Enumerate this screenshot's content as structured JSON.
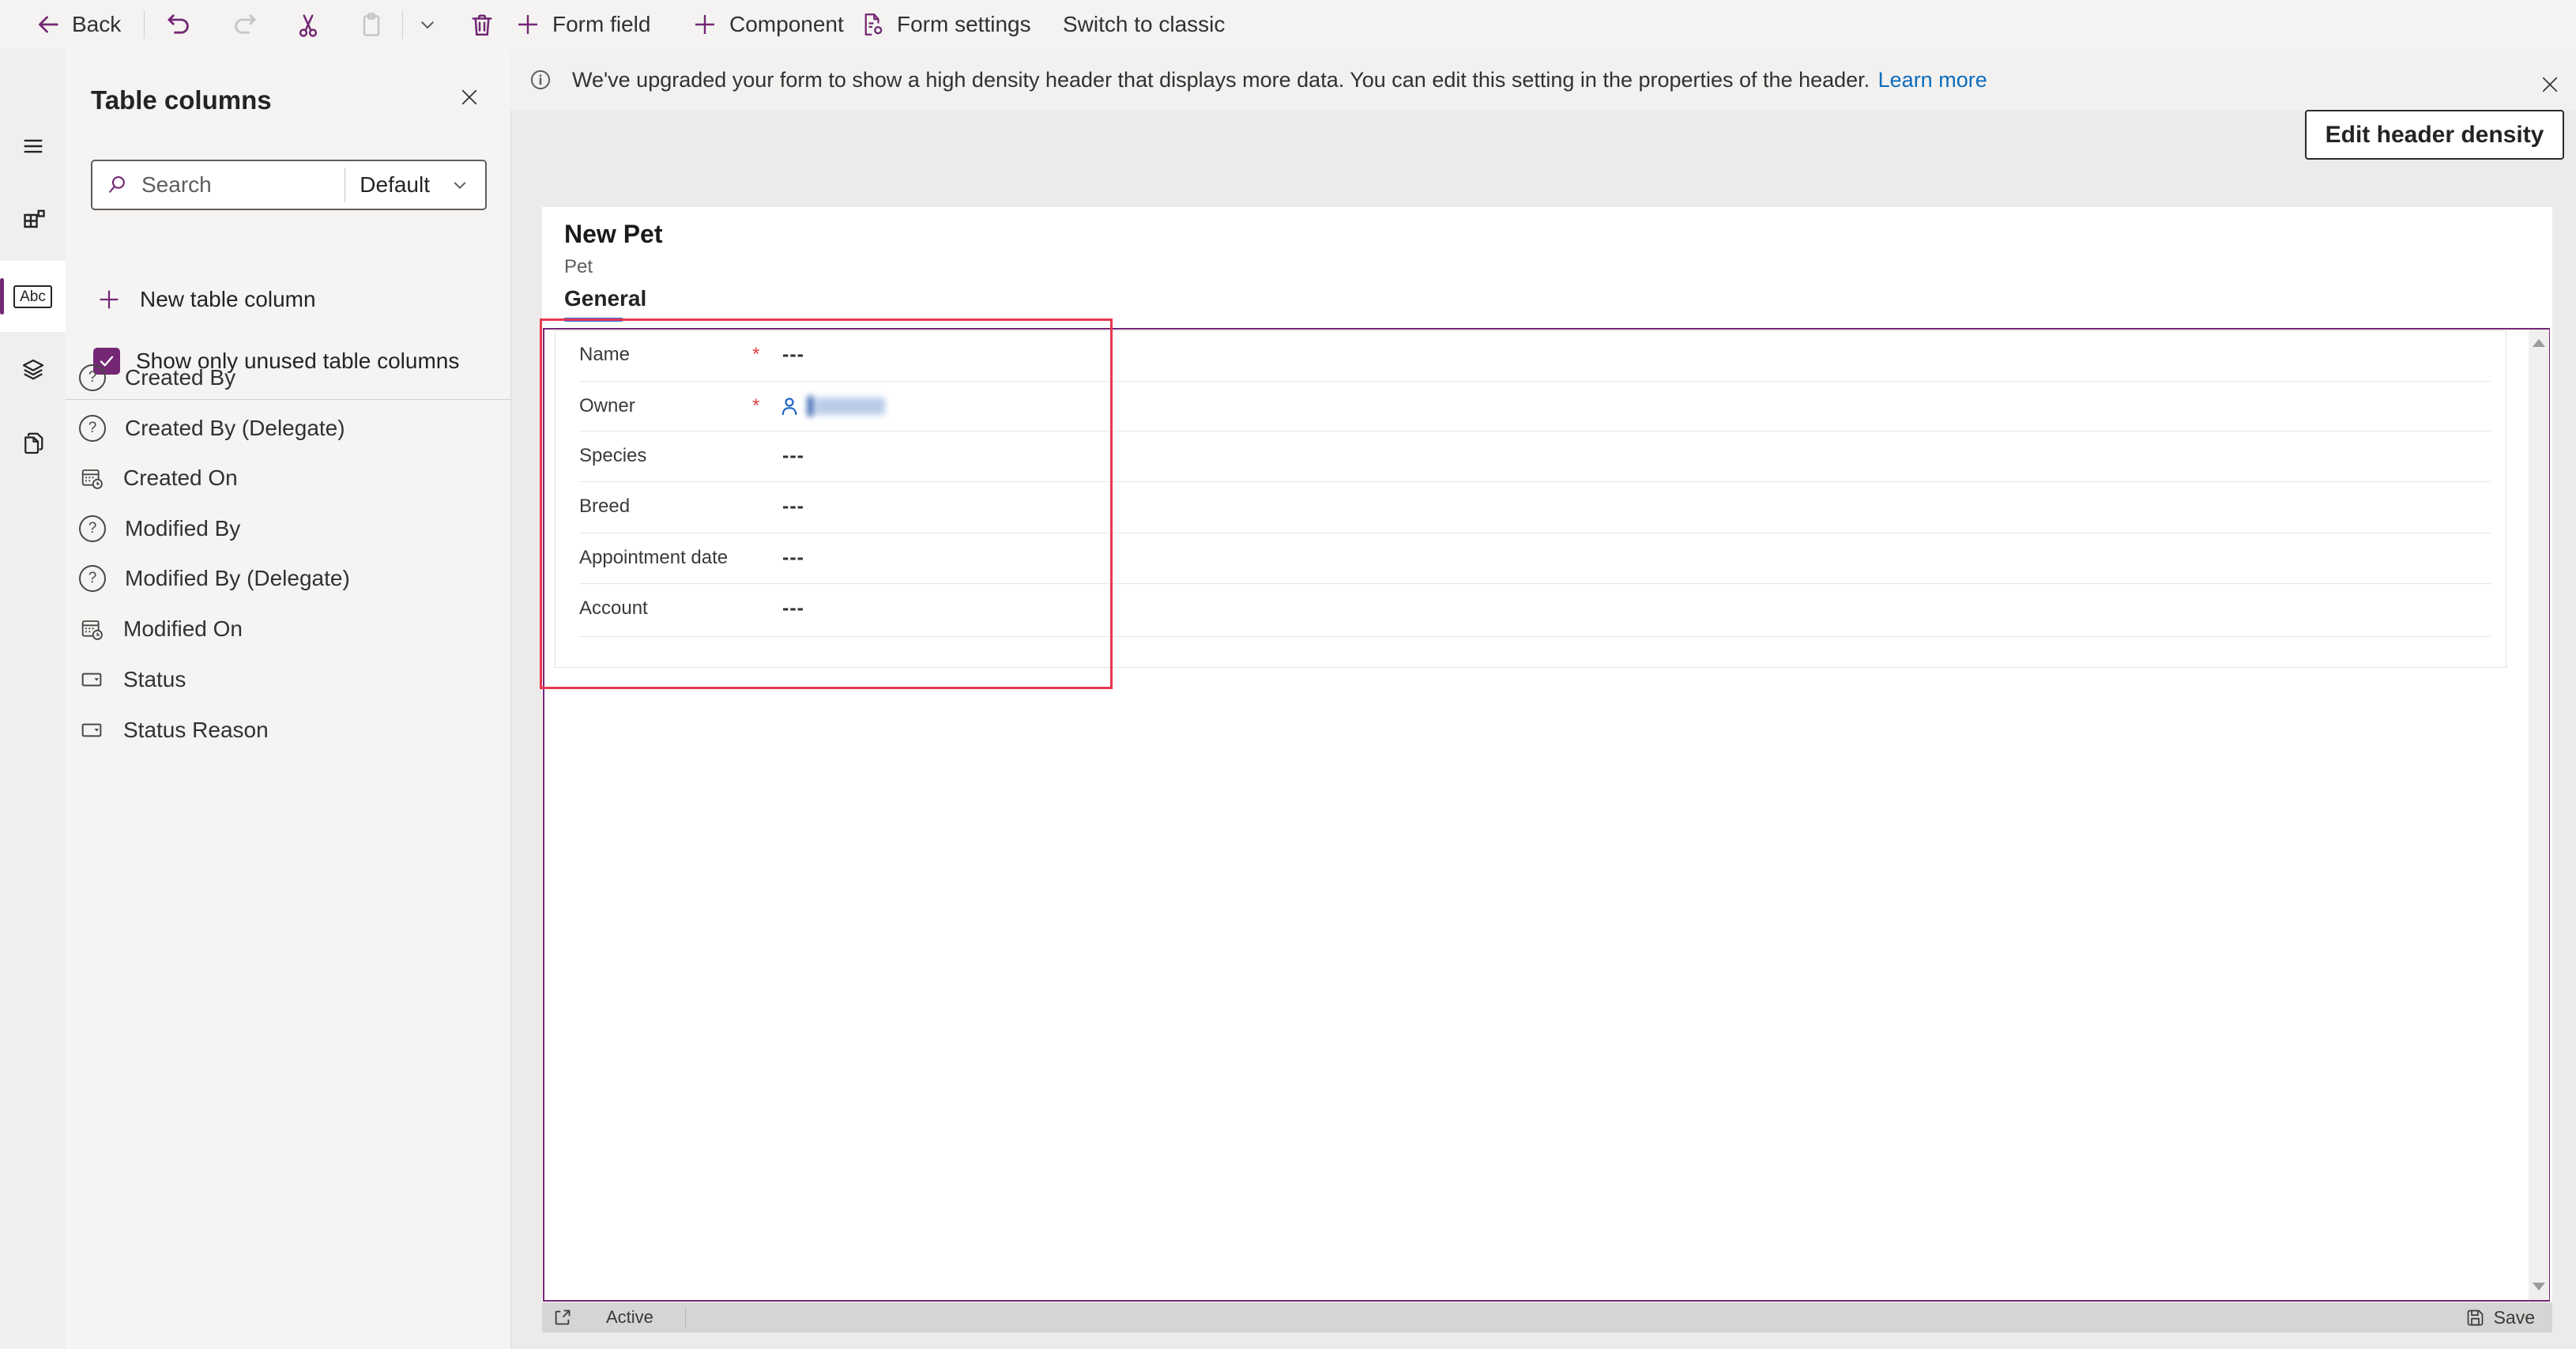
{
  "toolbar": {
    "back": "Back",
    "form_field": "Form field",
    "component": "Component",
    "form_settings": "Form settings",
    "switch_to_classic": "Switch to classic"
  },
  "left_rail": {
    "icons": [
      "hamburger-menu",
      "page-layout",
      "table-columns-abc",
      "layers",
      "copy-pages"
    ],
    "abc_glyph": "Abc",
    "selected": "table-columns-abc"
  },
  "panel": {
    "title": "Table columns",
    "search_placeholder": "Search",
    "filter_value": "Default",
    "new_table_column": "New table column",
    "show_unused": "Show only unused table columns",
    "show_unused_checked": true,
    "columns": [
      {
        "label": "Created By",
        "icon": "question-circle"
      },
      {
        "label": "Created By (Delegate)",
        "icon": "question-circle"
      },
      {
        "label": "Created On",
        "icon": "calendar-clock"
      },
      {
        "label": "Modified By",
        "icon": "question-circle"
      },
      {
        "label": "Modified By (Delegate)",
        "icon": "question-circle"
      },
      {
        "label": "Modified On",
        "icon": "calendar-clock"
      },
      {
        "label": "Status",
        "icon": "option-set"
      },
      {
        "label": "Status Reason",
        "icon": "option-set"
      }
    ]
  },
  "banner": {
    "message": "We've upgraded your form to show a high density header that displays more data. You can edit this setting in the properties of the header.",
    "link": "Learn more"
  },
  "header_actions": {
    "edit_header_density": "Edit header density"
  },
  "form": {
    "title": "New Pet",
    "subtitle": "Pet",
    "tabs": [
      {
        "label": "General",
        "active": true
      }
    ],
    "fields": [
      {
        "label": "Name",
        "required_mark": "*",
        "value": "---"
      },
      {
        "label": "Owner",
        "required_mark": "*",
        "value": "",
        "type": "lookup-person-redacted"
      },
      {
        "label": "Species",
        "value": "---"
      },
      {
        "label": "Breed",
        "value": "---"
      },
      {
        "label": "Appointment date",
        "value": "---"
      },
      {
        "label": "Account",
        "value": "---"
      }
    ]
  },
  "status_bar": {
    "status": "Active",
    "save": "Save"
  },
  "colors": {
    "accent_purple": "#742774",
    "selection_red": "#e8384f",
    "tab_underline_blue": "#2b6cde",
    "link_blue": "#0b6cbd",
    "required_red": "#e04343",
    "person_blue": "#2468c4"
  }
}
